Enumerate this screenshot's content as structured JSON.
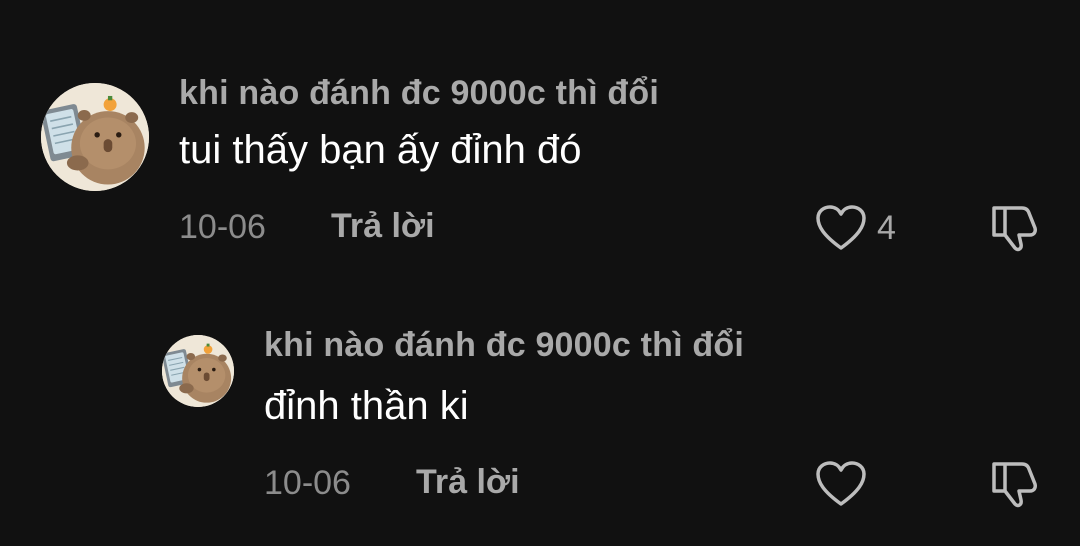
{
  "comments": [
    {
      "username": "khi nào đánh đc 9000c thì đổi",
      "text": "tui thấy bạn ấy đỉnh đó",
      "date": "10-06",
      "reply_label": "Trả lời",
      "like_count": "4",
      "avatar_icon": "capybara-avatar-icon"
    },
    {
      "username": "khi nào đánh đc 9000c thì đổi",
      "text": "đỉnh thần ki",
      "date": "10-06",
      "reply_label": "Trả lời",
      "like_count": "",
      "avatar_icon": "capybara-avatar-icon"
    }
  ],
  "colors": {
    "background": "#111111",
    "username": "#a9a9a9",
    "text": "#ffffff",
    "meta": "#8c8c8c",
    "icon": "#bdbdbd"
  }
}
